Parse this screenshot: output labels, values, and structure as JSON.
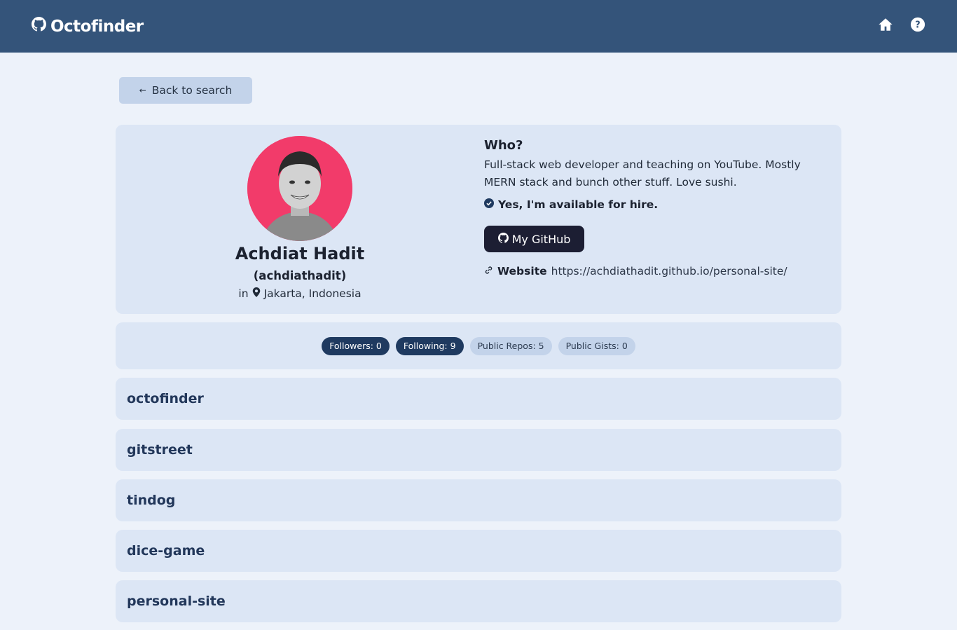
{
  "app": {
    "brand": "Octofinder"
  },
  "nav": {
    "home_icon": "home-icon",
    "help_icon": "help-icon"
  },
  "back_button": {
    "label": "Back to search",
    "arrow": "←"
  },
  "profile": {
    "name": "Achdiat Hadit",
    "login": "(achdiathadit)",
    "location_prefix": "in",
    "location": "Jakarta, Indonesia",
    "avatar_bg": "#f23b6a"
  },
  "about": {
    "title": "Who?",
    "bio": "Full-stack web developer and teaching on YouTube. Mostly MERN stack and bunch other stuff. Love sushi.",
    "hireable": "Yes, I'm available for hire.",
    "github_button": "My GitHub",
    "website_label": "Website",
    "website_url": "https://achdiathadit.github.io/personal-site/"
  },
  "stats": {
    "followers": "Followers: 0",
    "following": "Following: 9",
    "public_repos": "Public Repos: 5",
    "public_gists": "Public Gists: 0"
  },
  "repos": [
    {
      "name": "octofinder"
    },
    {
      "name": "gitstreet"
    },
    {
      "name": "tindog"
    },
    {
      "name": "dice-game"
    },
    {
      "name": "personal-site"
    }
  ],
  "colors": {
    "navbar": "#34547a",
    "background": "#edf2fa",
    "card": "#dce6f5",
    "dark_badge": "#1f3a60",
    "light_badge": "#c3d3ea",
    "github_button": "#1c1e33"
  }
}
